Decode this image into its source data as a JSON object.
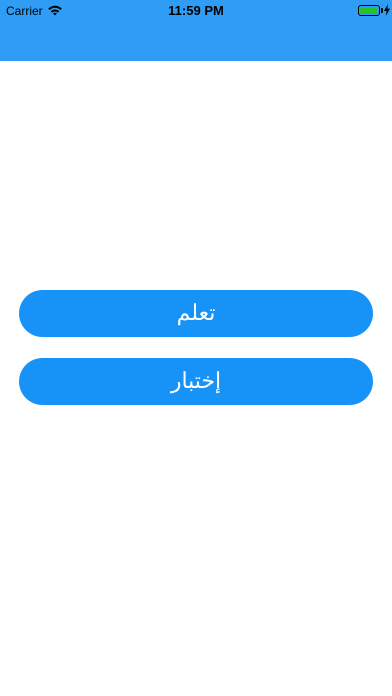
{
  "status_bar": {
    "carrier": "Carrier",
    "time": "11:59 PM",
    "battery_color": "#25c12f"
  },
  "header": {
    "color": "#2f9cf6"
  },
  "buttons": {
    "learn_label": "تعلم",
    "test_label": "إختبار",
    "color": "#1793f7"
  }
}
